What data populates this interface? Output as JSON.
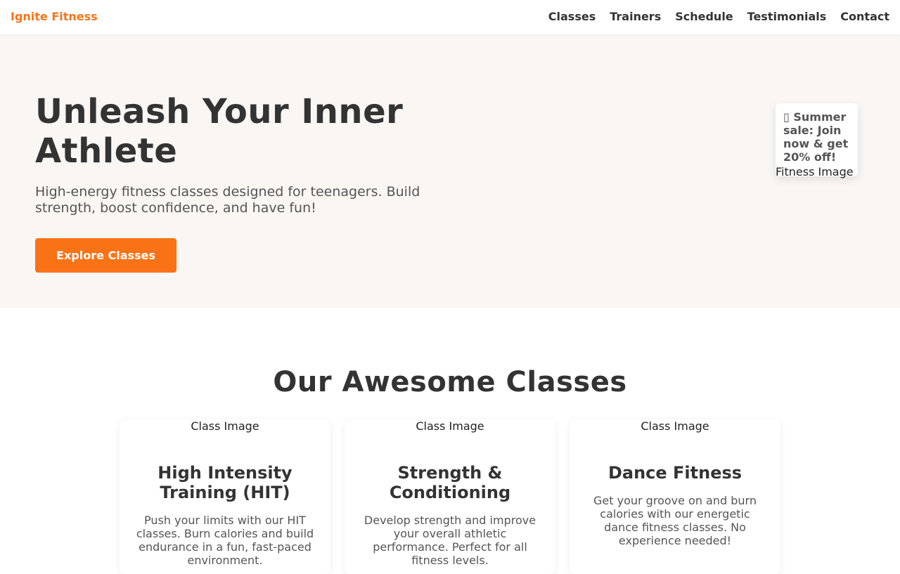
{
  "nav": {
    "brand": "Ignite Fitness",
    "links": [
      "Classes",
      "Trainers",
      "Schedule",
      "Testimonials",
      "Contact"
    ]
  },
  "hero": {
    "title": "Unleash Your Inner Athlete",
    "subtitle": "High-energy fitness classes designed for teenagers. Build strength, boost confidence, and have fun!",
    "cta_label": "Explore Classes",
    "promo_icon": "▯",
    "promo_text": "Summer sale: Join now & get 20% off!",
    "image_alt": "Fitness Image"
  },
  "classes": {
    "title": "Our Awesome Classes",
    "items": [
      {
        "image_alt": "Class Image",
        "name": "High Intensity Training (HIT)",
        "description": "Push your limits with our HIT classes. Burn calories and build endurance in a fun, fast-paced environment."
      },
      {
        "image_alt": "Class Image",
        "name": "Strength & Conditioning",
        "description": "Develop strength and improve your overall athletic performance. Perfect for all fitness levels."
      },
      {
        "image_alt": "Class Image",
        "name": "Dance Fitness",
        "description": "Get your groove on and burn calories with our energetic dance fitness classes. No experience needed!"
      }
    ]
  },
  "colors": {
    "accent": "#f97316",
    "hero_bg": "#f9f6f3",
    "text": "#333333"
  }
}
